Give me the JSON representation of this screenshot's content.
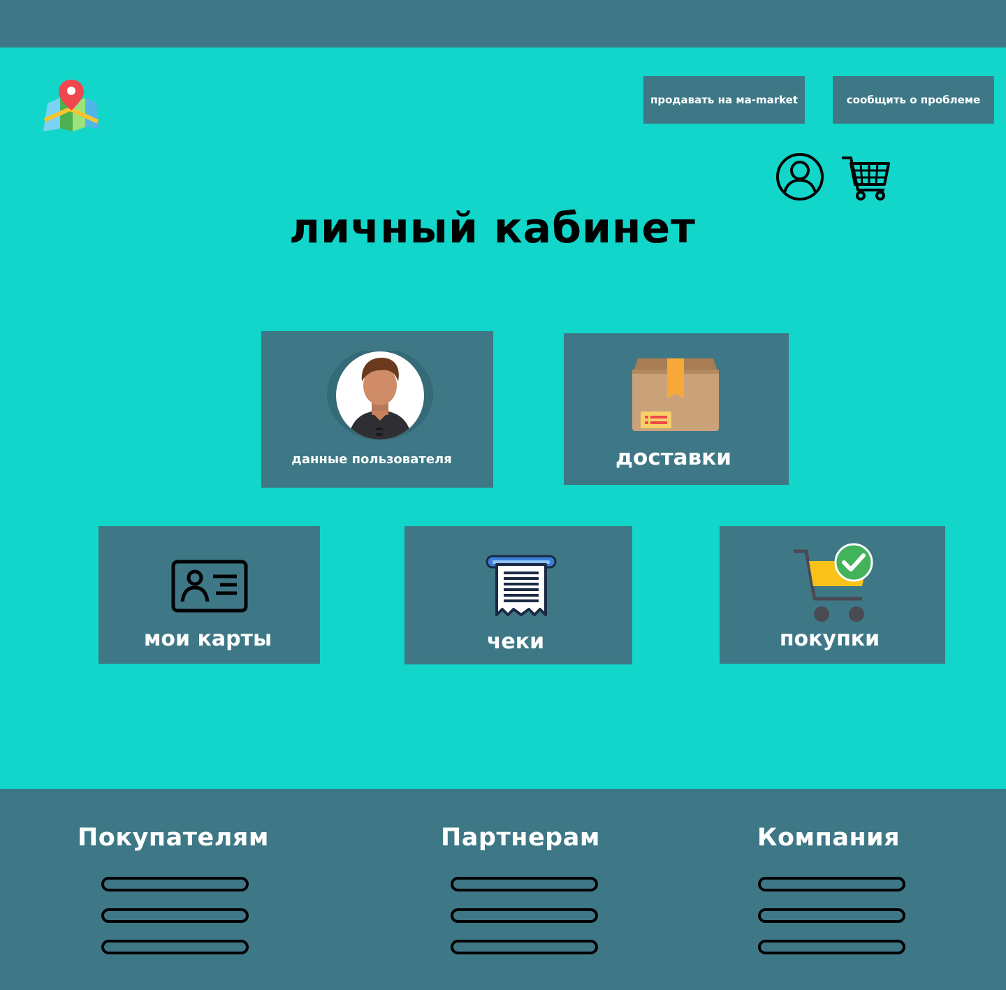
{
  "header": {
    "sell_button": "продавать на ма-market",
    "report_button": "сообщить о проблеме",
    "logo_icon": "map-pin-icon",
    "user_icon": "user-circle-icon",
    "cart_icon": "shopping-cart-icon"
  },
  "main": {
    "title": "личный кабинет",
    "tiles": [
      {
        "label": "данные пользователя",
        "icon": "avatar-icon"
      },
      {
        "label": "доставки",
        "icon": "package-box-icon"
      },
      {
        "label": "мои карты",
        "icon": "id-card-icon"
      },
      {
        "label": "чеки",
        "icon": "receipt-icon"
      },
      {
        "label": "покупки",
        "icon": "cart-check-icon"
      }
    ]
  },
  "footer": {
    "columns": [
      {
        "title": "Покупателям"
      },
      {
        "title": "Партнерам"
      },
      {
        "title": "Компания"
      }
    ]
  },
  "colors": {
    "background": "#12d6c9",
    "panel": "#3e7886",
    "text_light": "#ffffff",
    "text_dark": "#000000"
  }
}
